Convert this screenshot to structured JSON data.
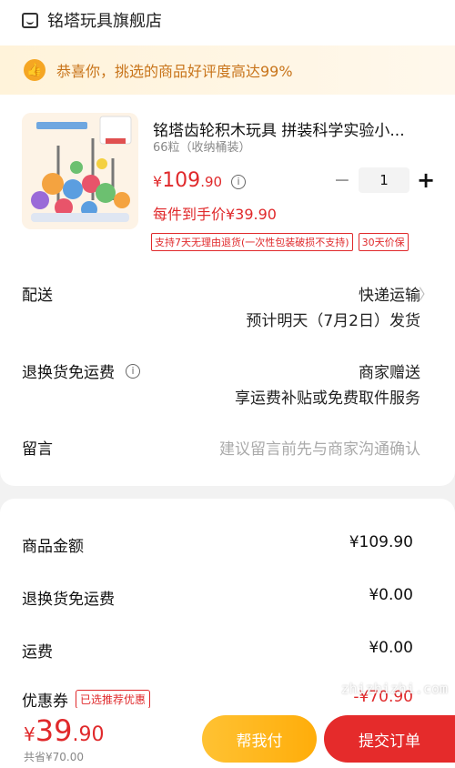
{
  "store": {
    "name": "铭塔玩具旗舰店",
    "icon": "store-icon"
  },
  "banner": {
    "text": "恭喜你，挑选的商品好评度高达99%",
    "icon": "thumbs-up-icon"
  },
  "product": {
    "title": "铭塔齿轮积木玩具 拼装科学实验小...",
    "spec": "66粒（收纳桶装）",
    "price_yen": "¥",
    "price_main": "109",
    "price_dec": ".90",
    "quantity": "1",
    "per_price": "每件到手价¥39.90",
    "tags": [
      "支持7天无理由退货(一次性包装破损不支持)",
      "30天价保"
    ],
    "accent_color": "#e0292b"
  },
  "delivery": {
    "label": "配送",
    "method": "快递运输",
    "eta": "预计明天（7月2日）发货"
  },
  "return_shipping": {
    "label": "退换货免运费",
    "value": "商家赠送",
    "desc": "享运费补贴或免费取件服务"
  },
  "message": {
    "label": "留言",
    "placeholder": "建议留言前先与商家沟通确认"
  },
  "summary": {
    "goods": {
      "label": "商品金额",
      "value": "¥109.90"
    },
    "return_fee": {
      "label": "退换货免运费",
      "value": "¥0.00"
    },
    "shipping": {
      "label": "运费",
      "value": "¥0.00"
    },
    "coupon": {
      "label": "优惠券",
      "tag": "已选推荐优惠",
      "value": "-¥70.90"
    }
  },
  "footer": {
    "total_yen": "¥",
    "total_main": "39",
    "total_dec": ".90",
    "total_sub": "共省¥70.00",
    "help_button": "帮我付",
    "pay_button": "提交订单"
  },
  "watermark": "zhizhizhi.com"
}
